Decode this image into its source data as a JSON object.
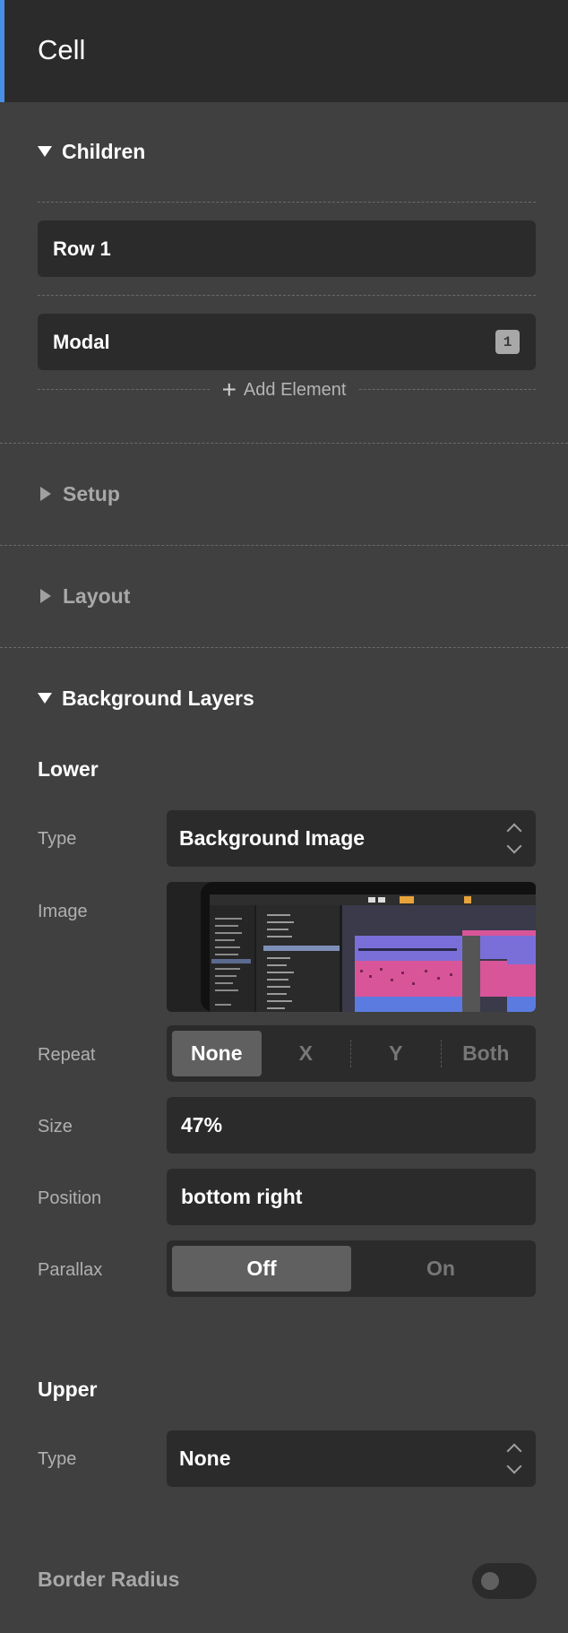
{
  "header": {
    "title": "Cell"
  },
  "children": {
    "heading": "Children",
    "items": [
      {
        "label": "Row 1",
        "badge": ""
      },
      {
        "label": "Modal",
        "badge": "1"
      }
    ],
    "add_label": "Add Element"
  },
  "sections": {
    "setup": "Setup",
    "layout": "Layout",
    "background": "Background Layers"
  },
  "background": {
    "lower": {
      "heading": "Lower",
      "type_label": "Type",
      "type_value": "Background Image",
      "image_label": "Image",
      "repeat_label": "Repeat",
      "repeat_options": [
        "None",
        "X",
        "Y",
        "Both"
      ],
      "repeat_selected": "None",
      "size_label": "Size",
      "size_value": "47%",
      "position_label": "Position",
      "position_value": "bottom right",
      "parallax_label": "Parallax",
      "parallax_options": [
        "Off",
        "On"
      ],
      "parallax_selected": "Off"
    },
    "upper": {
      "heading": "Upper",
      "type_label": "Type",
      "type_value": "None"
    }
  },
  "border_radius": {
    "label": "Border Radius",
    "enabled": false
  },
  "colors": {
    "accent": "#4a8fe7",
    "panel": "#404040",
    "field": "#2b2b2b",
    "active_segment": "#606060"
  }
}
